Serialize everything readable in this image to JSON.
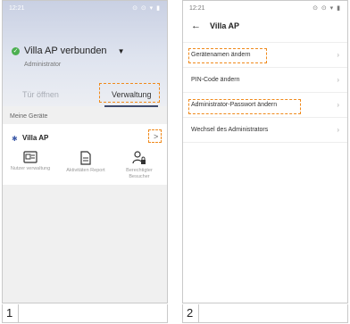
{
  "panel1": {
    "statusbar": {
      "time": "12:21",
      "icons": "⊙ ⊙ ▾ ▮"
    },
    "device": {
      "name": "Villa AP verbunden",
      "role": "Administrator"
    },
    "tabs": {
      "open": "Tür öffnen",
      "admin": "Verwaltung"
    },
    "section": "Meine Geräte",
    "card": {
      "title": "Villa AP",
      "chevron": ">"
    },
    "features": [
      {
        "icon": "id-card-icon",
        "label": "Nutzer verwaltung"
      },
      {
        "icon": "document-icon",
        "label": "Aktivitäten Report"
      },
      {
        "icon": "user-lock-icon",
        "label": "Berechtigter Besucher"
      }
    ],
    "caption": "1"
  },
  "panel2": {
    "statusbar": {
      "time": "12:21",
      "icons": "⊙ ⊙ ▾ ▮"
    },
    "title": "Villa AP",
    "menu": [
      {
        "label": "Gerätenamen ändern"
      },
      {
        "label": "PIN-Code ändern"
      },
      {
        "label": "Administrator-Passwort ändern"
      },
      {
        "label": "Wechsel des Administrators"
      }
    ],
    "caption": "2"
  },
  "colors": {
    "highlight": "#f08a1c",
    "accent": "#3f4a6b",
    "connected": "#4caf50"
  }
}
